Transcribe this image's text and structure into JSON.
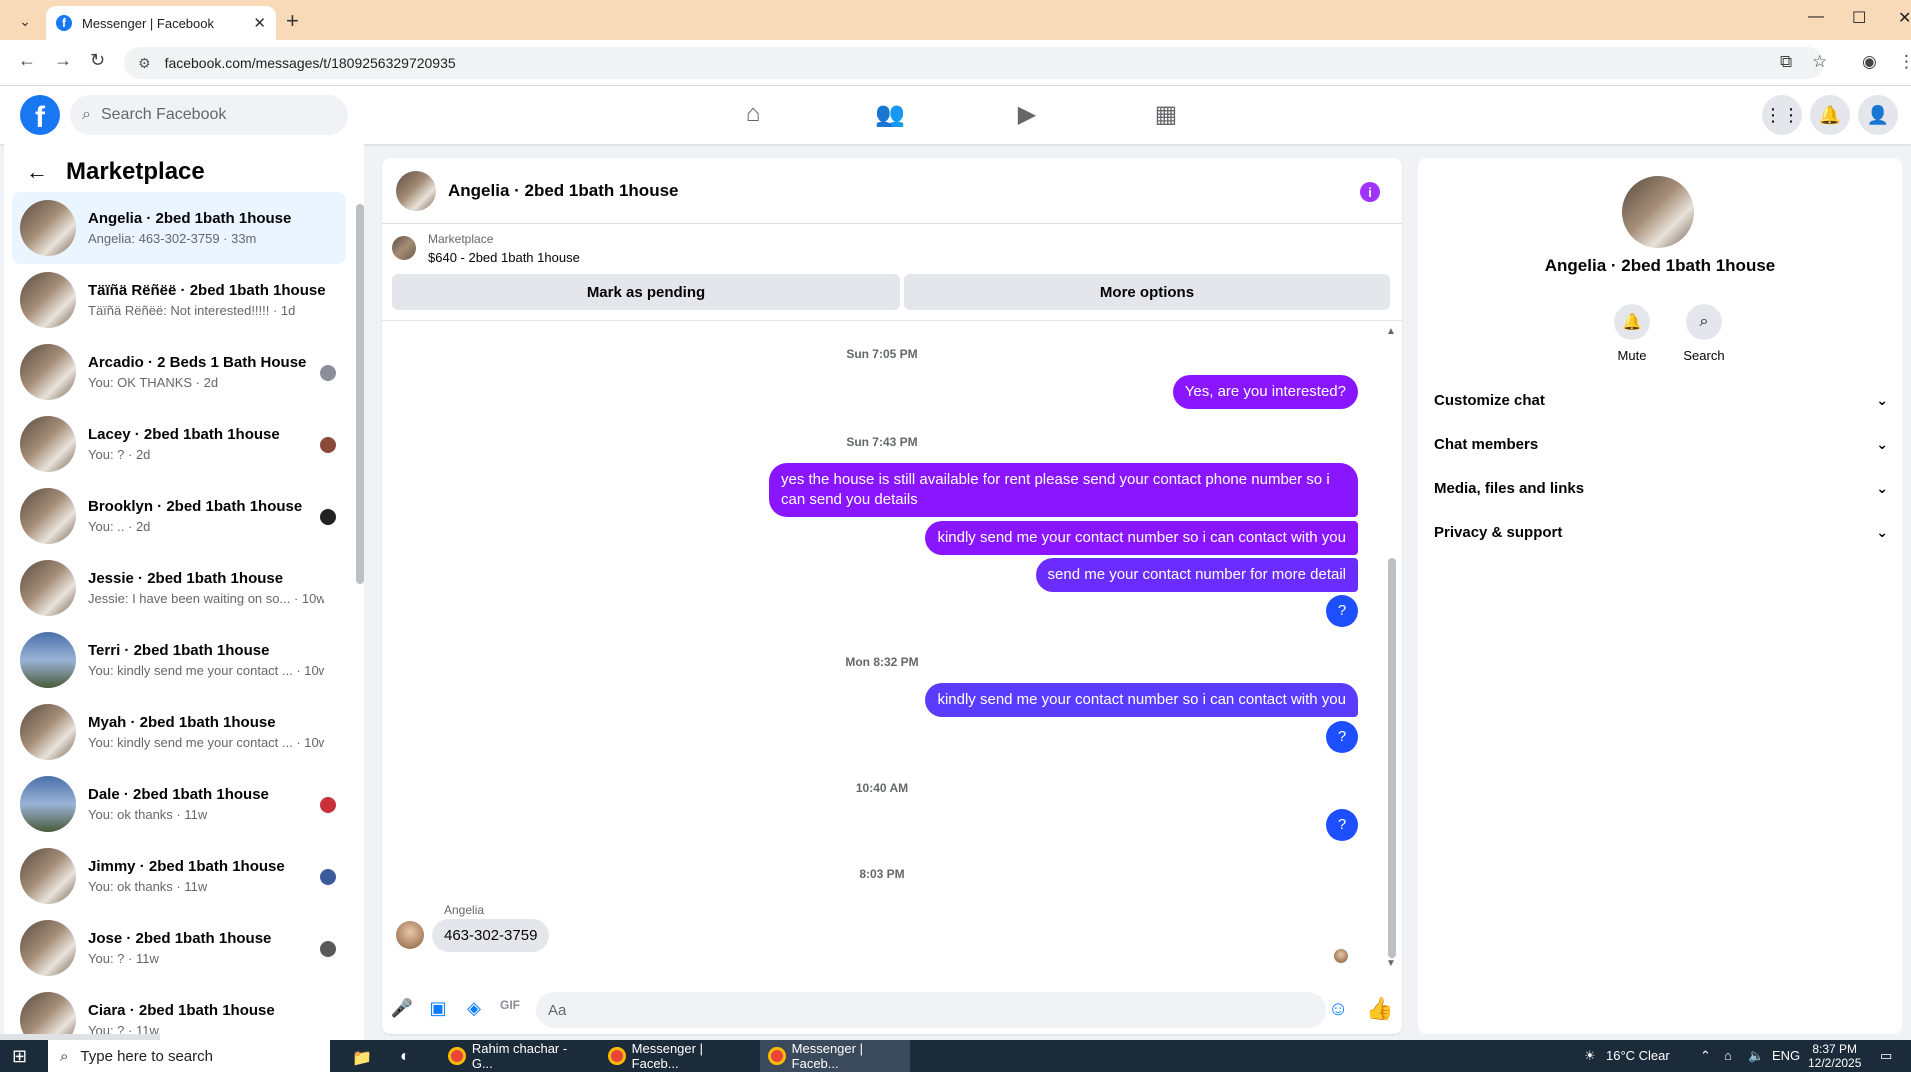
{
  "browser": {
    "tab_title": "Messenger | Facebook",
    "favicon": "f",
    "close_glyph": "✕",
    "new_tab": "+",
    "url": "facebook.com/messages/t/1809256329720935"
  },
  "fb": {
    "logo": "f",
    "search_placeholder": "Search Facebook"
  },
  "left": {
    "title": "Marketplace",
    "conversations": [
      {
        "name": "Angelia · 2bed 1bath 1house",
        "preview": "Angelia: 463-302-3759 · 33m"
      },
      {
        "name": "Täïñä Rëñëë · 2bed 1bath 1house",
        "preview": "Täïñä Rëñëë: Not interested!!!!! · 1d"
      },
      {
        "name": "Arcadio · 2 Beds 1 Bath House",
        "preview": "You: OK THANKS · 2d"
      },
      {
        "name": "Lacey · 2bed 1bath 1house",
        "preview": "You: ? · 2d"
      },
      {
        "name": "Brooklyn · 2bed 1bath 1house",
        "preview": "You: .. · 2d"
      },
      {
        "name": "Jessie · 2bed 1bath 1house",
        "preview": "Jessie: I have been waiting on so... · 10w"
      },
      {
        "name": "Terri · 2bed 1bath 1house",
        "preview": "You: kindly send me your contact ... · 10w"
      },
      {
        "name": "Myah · 2bed 1bath 1house",
        "preview": "You: kindly send me your contact ... · 10w"
      },
      {
        "name": "Dale · 2bed 1bath 1house",
        "preview": "You: ok thanks · 11w"
      },
      {
        "name": "Jimmy · 2bed 1bath 1house",
        "preview": "You: ok thanks · 11w"
      },
      {
        "name": "Jose · 2bed 1bath 1house",
        "preview": "You: ? · 11w"
      },
      {
        "name": "Ciara · 2bed 1bath 1house",
        "preview": "You: ? · 11w"
      }
    ]
  },
  "chat": {
    "title": "Angelia · 2bed 1bath 1house",
    "listing_label": "Marketplace",
    "listing_value": "$640 - 2bed 1bath 1house",
    "mark_pending": "Mark as pending",
    "more_options": "More options",
    "ts1": "Sun 7:05 PM",
    "msg1": "Yes, are you interested?",
    "ts2": "Sun 7:43 PM",
    "msg2": "yes the house is still available for rent please send your contact phone number so i can send you details",
    "msg3": "kindly send me your contact number so i can contact with you",
    "msg4": "send me your contact number for more detail",
    "msg5": "?",
    "ts3": "Mon 8:32 PM",
    "msg6": "kindly send me your contact number so i can contact with you",
    "msg7": "?",
    "ts4": "10:40 AM",
    "msg8": "?",
    "ts5": "8:03 PM",
    "sender": "Angelia",
    "incoming": "463-302-3759",
    "composer_placeholder": "Aa"
  },
  "info": {
    "name": "Angelia · 2bed 1bath 1house",
    "mute": "Mute",
    "search": "Search",
    "sections": [
      "Customize chat",
      "Chat members",
      "Media, files and links",
      "Privacy & support"
    ]
  },
  "taskbar": {
    "search_placeholder": "Type here to search",
    "apps": [
      "Rahim chachar - G...",
      "Messenger | Faceb...",
      "Messenger | Faceb..."
    ],
    "weather": "16°C  Clear",
    "lang": "ENG",
    "time": "8:37 PM",
    "date": "12/2/2025"
  },
  "colors": {
    "outgoing_purple": "#8a16ff",
    "outgoing_blue": "#1d4fff",
    "fb_blue": "#1877f2",
    "active_row": "#ebf5ff"
  }
}
